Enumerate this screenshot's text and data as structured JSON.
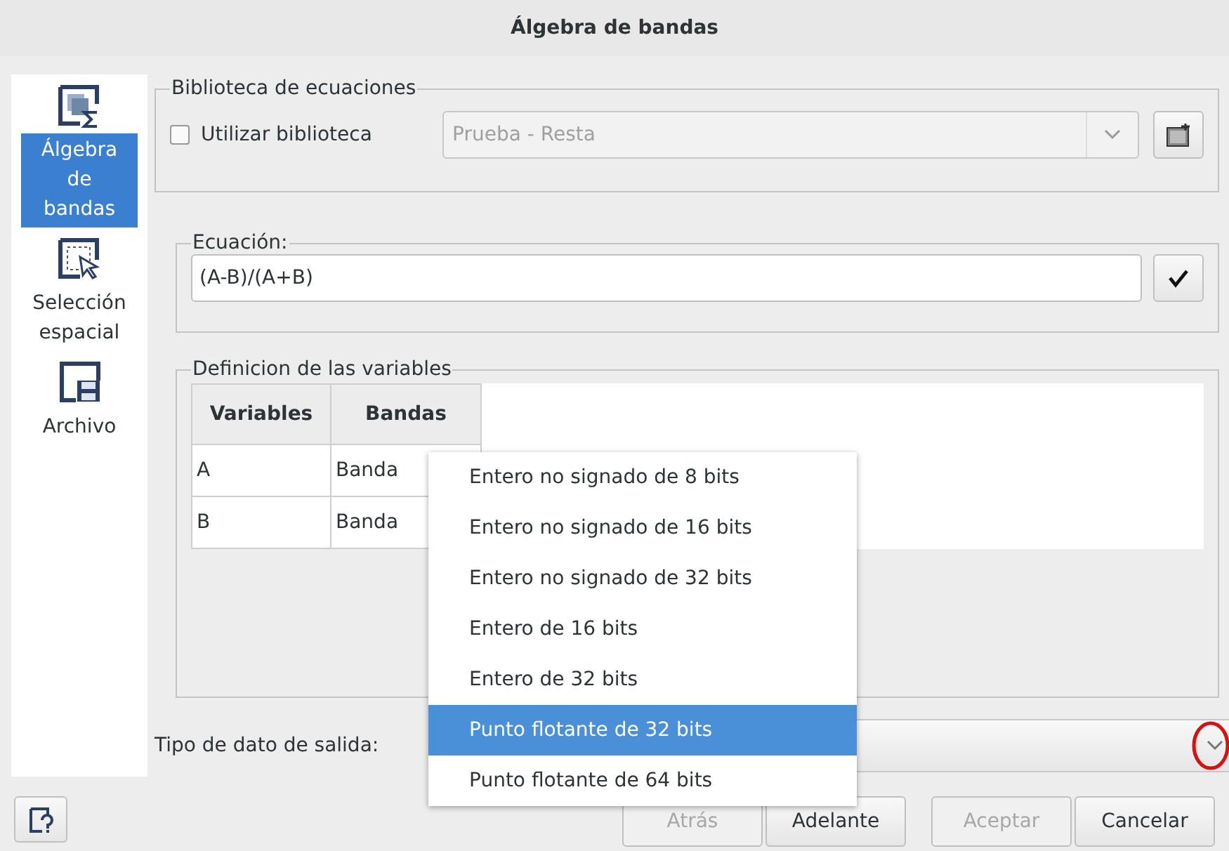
{
  "window": {
    "title": "Álgebra de bandas"
  },
  "sidebar": {
    "items": [
      {
        "label": "Álgebra de bandas",
        "kind": "algebra",
        "selected": true
      },
      {
        "label": "Selección espacial",
        "kind": "selection",
        "selected": false
      },
      {
        "label": "Archivo",
        "kind": "file",
        "selected": false
      }
    ]
  },
  "library": {
    "title": "Biblioteca de ecuaciones",
    "checkbox": {
      "label": "Utilizar biblioteca",
      "checked": false
    },
    "combo": {
      "value": "Prueba - Resta",
      "disabled": true
    }
  },
  "equation": {
    "title": "Ecuación:",
    "value": "(A-B)/(A+B)"
  },
  "variables": {
    "title": "Definicion de las variables",
    "columns": [
      "Variables",
      "Bandas"
    ],
    "rows": [
      [
        "A",
        "Banda"
      ],
      [
        "B",
        "Banda"
      ]
    ]
  },
  "output": {
    "label": "Tipo de dato de salida:"
  },
  "menu": {
    "items": [
      {
        "label": "Entero no signado de 8 bits",
        "selected": false
      },
      {
        "label": "Entero no signado de 16 bits",
        "selected": false
      },
      {
        "label": "Entero no signado de 32 bits",
        "selected": false
      },
      {
        "label": "Entero de 16 bits",
        "selected": false
      },
      {
        "label": "Entero de 32 bits",
        "selected": false
      },
      {
        "label": "Punto flotante de 32 bits",
        "selected": true
      },
      {
        "label": "Punto flotante de 64 bits",
        "selected": false
      }
    ]
  },
  "buttons": [
    {
      "label": "Atrás",
      "disabled": true
    },
    {
      "label": "Adelante",
      "disabled": false
    },
    {
      "label": "Aceptar",
      "disabled": true
    },
    {
      "label": "Cancelar",
      "disabled": false
    }
  ]
}
